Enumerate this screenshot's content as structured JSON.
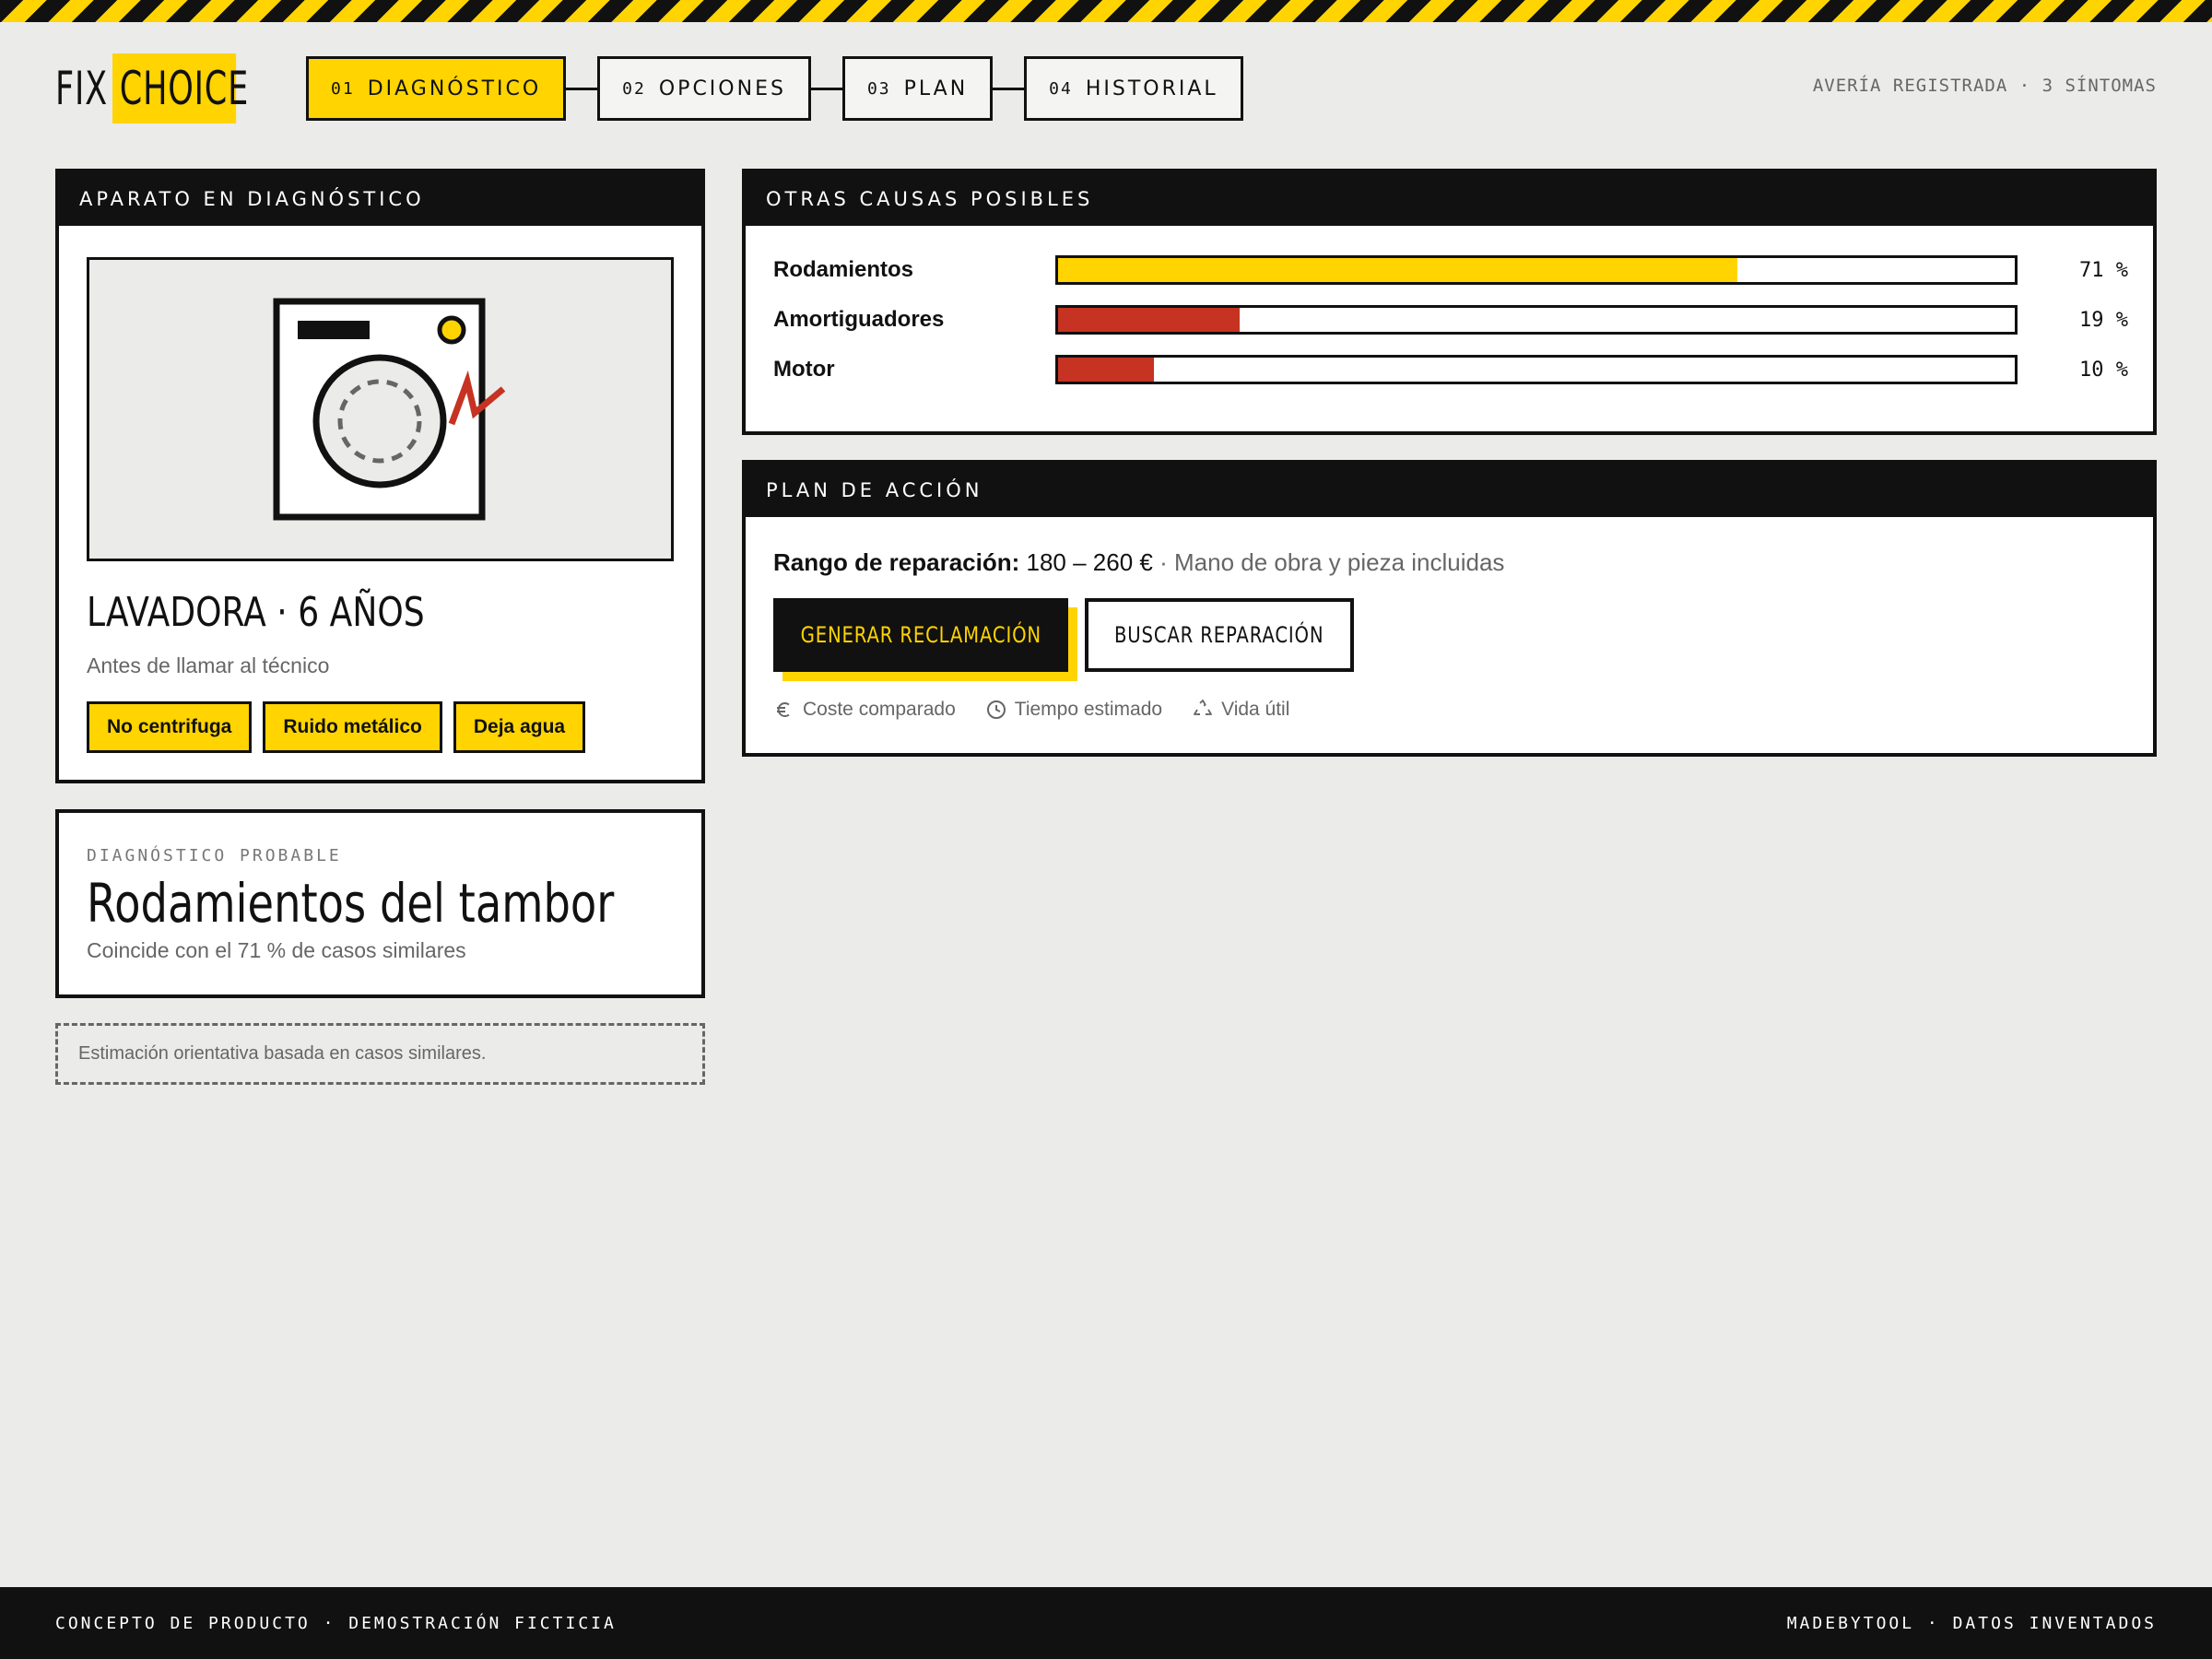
{
  "logo": {
    "part1": "FIX",
    "part2": "CHOICE"
  },
  "steps": [
    {
      "num": "01",
      "label": "DIAGNÓSTICO",
      "active": true
    },
    {
      "num": "02",
      "label": "OPCIONES",
      "active": false
    },
    {
      "num": "03",
      "label": "PLAN",
      "active": false
    },
    {
      "num": "04",
      "label": "HISTORIAL",
      "active": false
    }
  ],
  "header": {
    "status": "AVERÍA REGISTRADA · 3 SÍNTOMAS"
  },
  "device": {
    "panel_title": "APARATO EN DIAGNÓSTICO",
    "title": "LAVADORA · 6 AÑOS",
    "subtitle": "Antes de llamar al técnico",
    "symptoms": [
      "No centrifuga",
      "Ruido metálico",
      "Deja agua"
    ]
  },
  "diagnosis": {
    "kicker": "DIAGNÓSTICO PROBABLE",
    "title": "Rodamientos del tambor",
    "subtitle": "Coincide con el 71 % de casos similares"
  },
  "note": "Estimación orientativa basada en casos similares.",
  "causes": {
    "panel_title": "OTRAS CAUSAS POSIBLES",
    "items": [
      {
        "name": "Rodamientos",
        "pct_label": "71 %",
        "value": 71,
        "color": "#ffd400"
      },
      {
        "name": "Amortiguadores",
        "pct_label": "19 %",
        "value": 19,
        "color": "#c63322"
      },
      {
        "name": "Motor",
        "pct_label": "10 %",
        "value": 10,
        "color": "#c63322"
      }
    ]
  },
  "plan": {
    "panel_title": "PLAN DE ACCIÓN",
    "range_label": "Rango de reparación:",
    "range_value": "180 – 260 €",
    "separator": " · ",
    "range_note": "Mano de obra y pieza incluidas",
    "primary_button": "GENERAR RECLAMACIÓN",
    "secondary_button": "BUSCAR REPARACIÓN",
    "features": [
      {
        "icon": "euro-icon",
        "label": "Coste comparado"
      },
      {
        "icon": "clock-icon",
        "label": "Tiempo estimado"
      },
      {
        "icon": "recycle-icon",
        "label": "Vida útil"
      }
    ]
  },
  "footer": {
    "left": "CONCEPTO DE PRODUCTO · DEMOSTRACIÓN FICTICIA",
    "right": "MADEBYTOOL · DATOS INVENTADOS"
  },
  "colors": {
    "accent": "#ffd400",
    "alert": "#c63322",
    "ink": "#111111",
    "background": "#ebebe9"
  }
}
